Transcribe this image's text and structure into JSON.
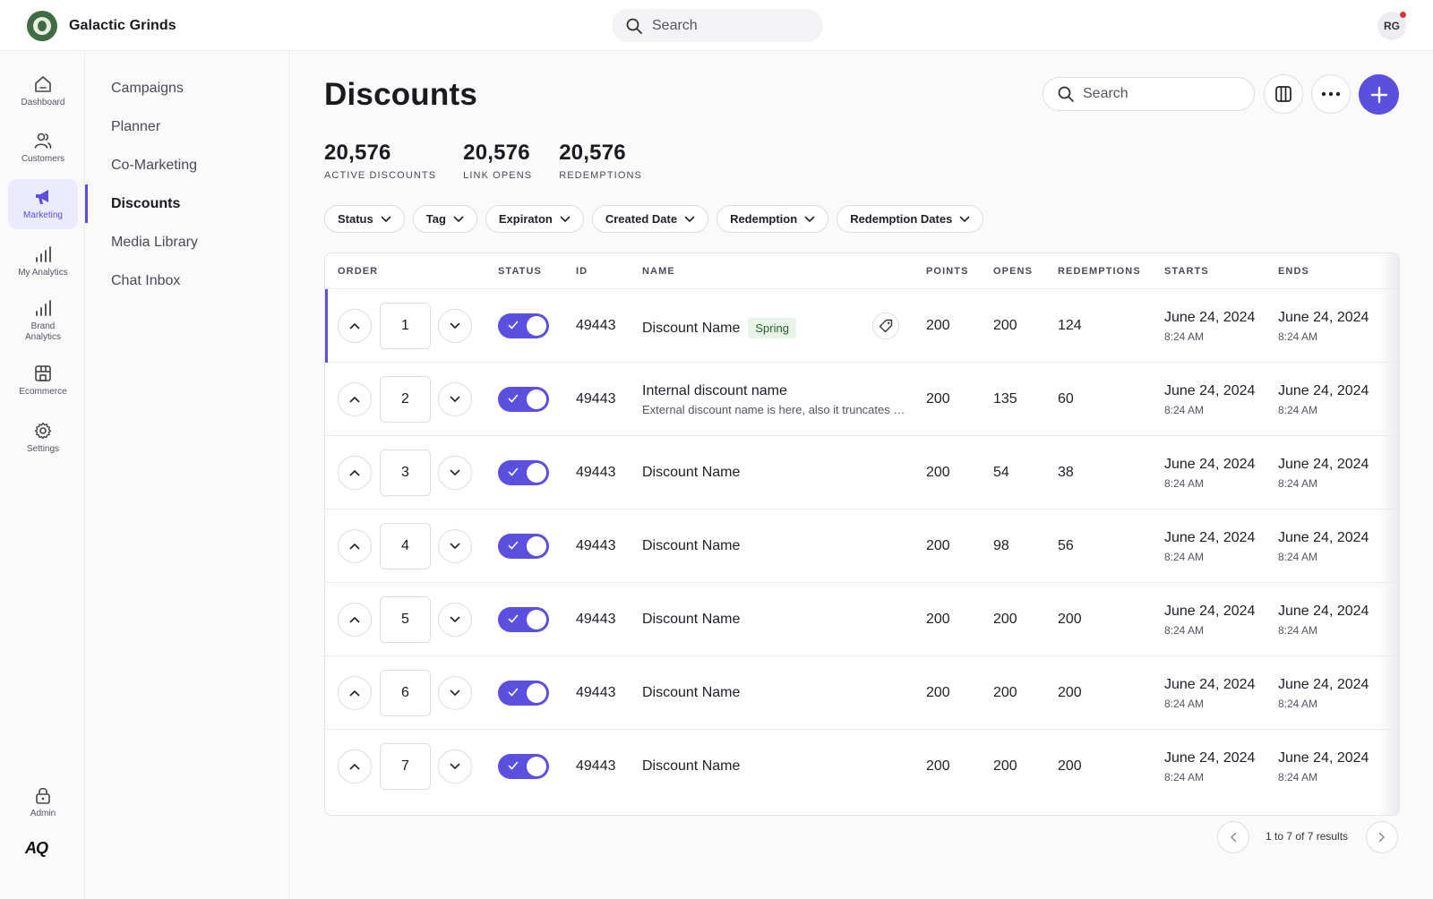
{
  "app": {
    "brand_name": "Galactic Grinds",
    "search_placeholder": "Search",
    "avatar_initials": "RG",
    "notification_color": "#e0343a",
    "accent_color": "#5b4fe0"
  },
  "rail": {
    "items": [
      {
        "label": "Dashboard",
        "icon": "home-icon"
      },
      {
        "label": "Customers",
        "icon": "users-icon"
      },
      {
        "label": "Marketing",
        "icon": "megaphone-icon",
        "active": true
      },
      {
        "label": "My Analytics",
        "icon": "bar-chart-icon"
      },
      {
        "label": "Brand Analytics",
        "icon": "bar-chart-icon"
      },
      {
        "label": "Ecommerce",
        "icon": "store-icon"
      },
      {
        "label": "Settings",
        "icon": "gear-icon"
      }
    ],
    "admin_label": "Admin",
    "logo_text": "AQ"
  },
  "subnav": {
    "items": [
      "Campaigns",
      "Planner",
      "Co-Marketing",
      "Discounts",
      "Media Library",
      "Chat Inbox"
    ],
    "active": "Discounts"
  },
  "page": {
    "title": "Discounts",
    "search_placeholder": "Search"
  },
  "stats": [
    {
      "value": "20,576",
      "label": "ACTIVE DISCOUNTS"
    },
    {
      "value": "20,576",
      "label": "LINK OPENS"
    },
    {
      "value": "20,576",
      "label": "REDEMPTIONS"
    }
  ],
  "filters": [
    "Status",
    "Tag",
    "Expiraton",
    "Created Date",
    "Redemption",
    "Redemption Dates"
  ],
  "table": {
    "columns": [
      "ORDER",
      "STATUS",
      "ID",
      "NAME",
      "POINTS",
      "OPENS",
      "REDEMPTIONS",
      "STARTS",
      "ENDS"
    ],
    "rows": [
      {
        "order": "1",
        "enabled": true,
        "id": "49443",
        "name": "Discount Name",
        "tag": "Spring",
        "points": "200",
        "opens": "200",
        "redemptions": "124",
        "start_date": "June 24, 2024",
        "start_time": "8:24 AM",
        "end_date": "June 24, 2024",
        "end_time": "8:24 AM"
      },
      {
        "order": "2",
        "enabled": true,
        "id": "49443",
        "name": "Internal discount name",
        "subtitle": "External discount name is here, also it truncates ab...",
        "points": "200",
        "opens": "135",
        "redemptions": "60",
        "start_date": "June 24, 2024",
        "start_time": "8:24 AM",
        "end_date": "June 24, 2024",
        "end_time": "8:24 AM"
      },
      {
        "order": "3",
        "enabled": true,
        "id": "49443",
        "name": "Discount Name",
        "points": "200",
        "opens": "54",
        "redemptions": "38",
        "start_date": "June 24, 2024",
        "start_time": "8:24 AM",
        "end_date": "June 24, 2024",
        "end_time": "8:24 AM"
      },
      {
        "order": "4",
        "enabled": true,
        "id": "49443",
        "name": "Discount Name",
        "points": "200",
        "opens": "98",
        "redemptions": "56",
        "start_date": "June 24, 2024",
        "start_time": "8:24 AM",
        "end_date": "June 24, 2024",
        "end_time": "8:24 AM"
      },
      {
        "order": "5",
        "enabled": true,
        "id": "49443",
        "name": "Discount Name",
        "points": "200",
        "opens": "200",
        "redemptions": "200",
        "start_date": "June 24, 2024",
        "start_time": "8:24 AM",
        "end_date": "June 24, 2024",
        "end_time": "8:24 AM"
      },
      {
        "order": "6",
        "enabled": true,
        "id": "49443",
        "name": "Discount Name",
        "points": "200",
        "opens": "200",
        "redemptions": "200",
        "start_date": "June 24, 2024",
        "start_time": "8:24 AM",
        "end_date": "June 24, 2024",
        "end_time": "8:24 AM"
      },
      {
        "order": "7",
        "enabled": true,
        "id": "49443",
        "name": "Discount Name",
        "points": "200",
        "opens": "200",
        "redemptions": "200",
        "start_date": "June 24, 2024",
        "start_time": "8:24 AM",
        "end_date": "June 24, 2024",
        "end_time": "8:24 AM"
      }
    ]
  },
  "pagination": {
    "summary": "1 to 7 of 7 results"
  }
}
